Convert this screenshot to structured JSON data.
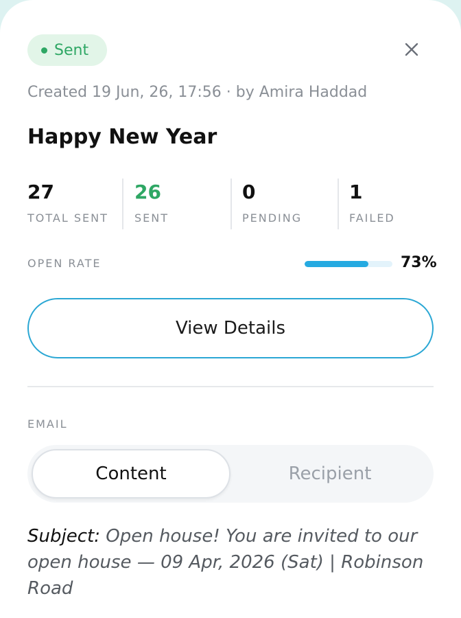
{
  "status": {
    "label": "Sent",
    "color": "#2ea764"
  },
  "close_icon": "close-icon",
  "meta": "Created 19 Jun, 26, 17:56 · by Amira Haddad",
  "title": "Happy New Year",
  "stats": [
    {
      "value": "27",
      "label": "TOTAL SENT"
    },
    {
      "value": "26",
      "label": "SENT"
    },
    {
      "value": "0",
      "label": "PENDING"
    },
    {
      "value": "1",
      "label": "FAILED"
    }
  ],
  "open_rate": {
    "label": "OPEN RATE",
    "value_text": "73%",
    "fraction": 0.73
  },
  "view_details_label": "View Details",
  "section_label": "EMAIL",
  "tabs": {
    "content": "Content",
    "recipient": "Recipient",
    "selected": "Content"
  },
  "content": {
    "subject_key": "Subject",
    "subject_value": "Open house! You are invited to our open house — 09 Apr, 2026 (Sat) | Robinson Road"
  }
}
